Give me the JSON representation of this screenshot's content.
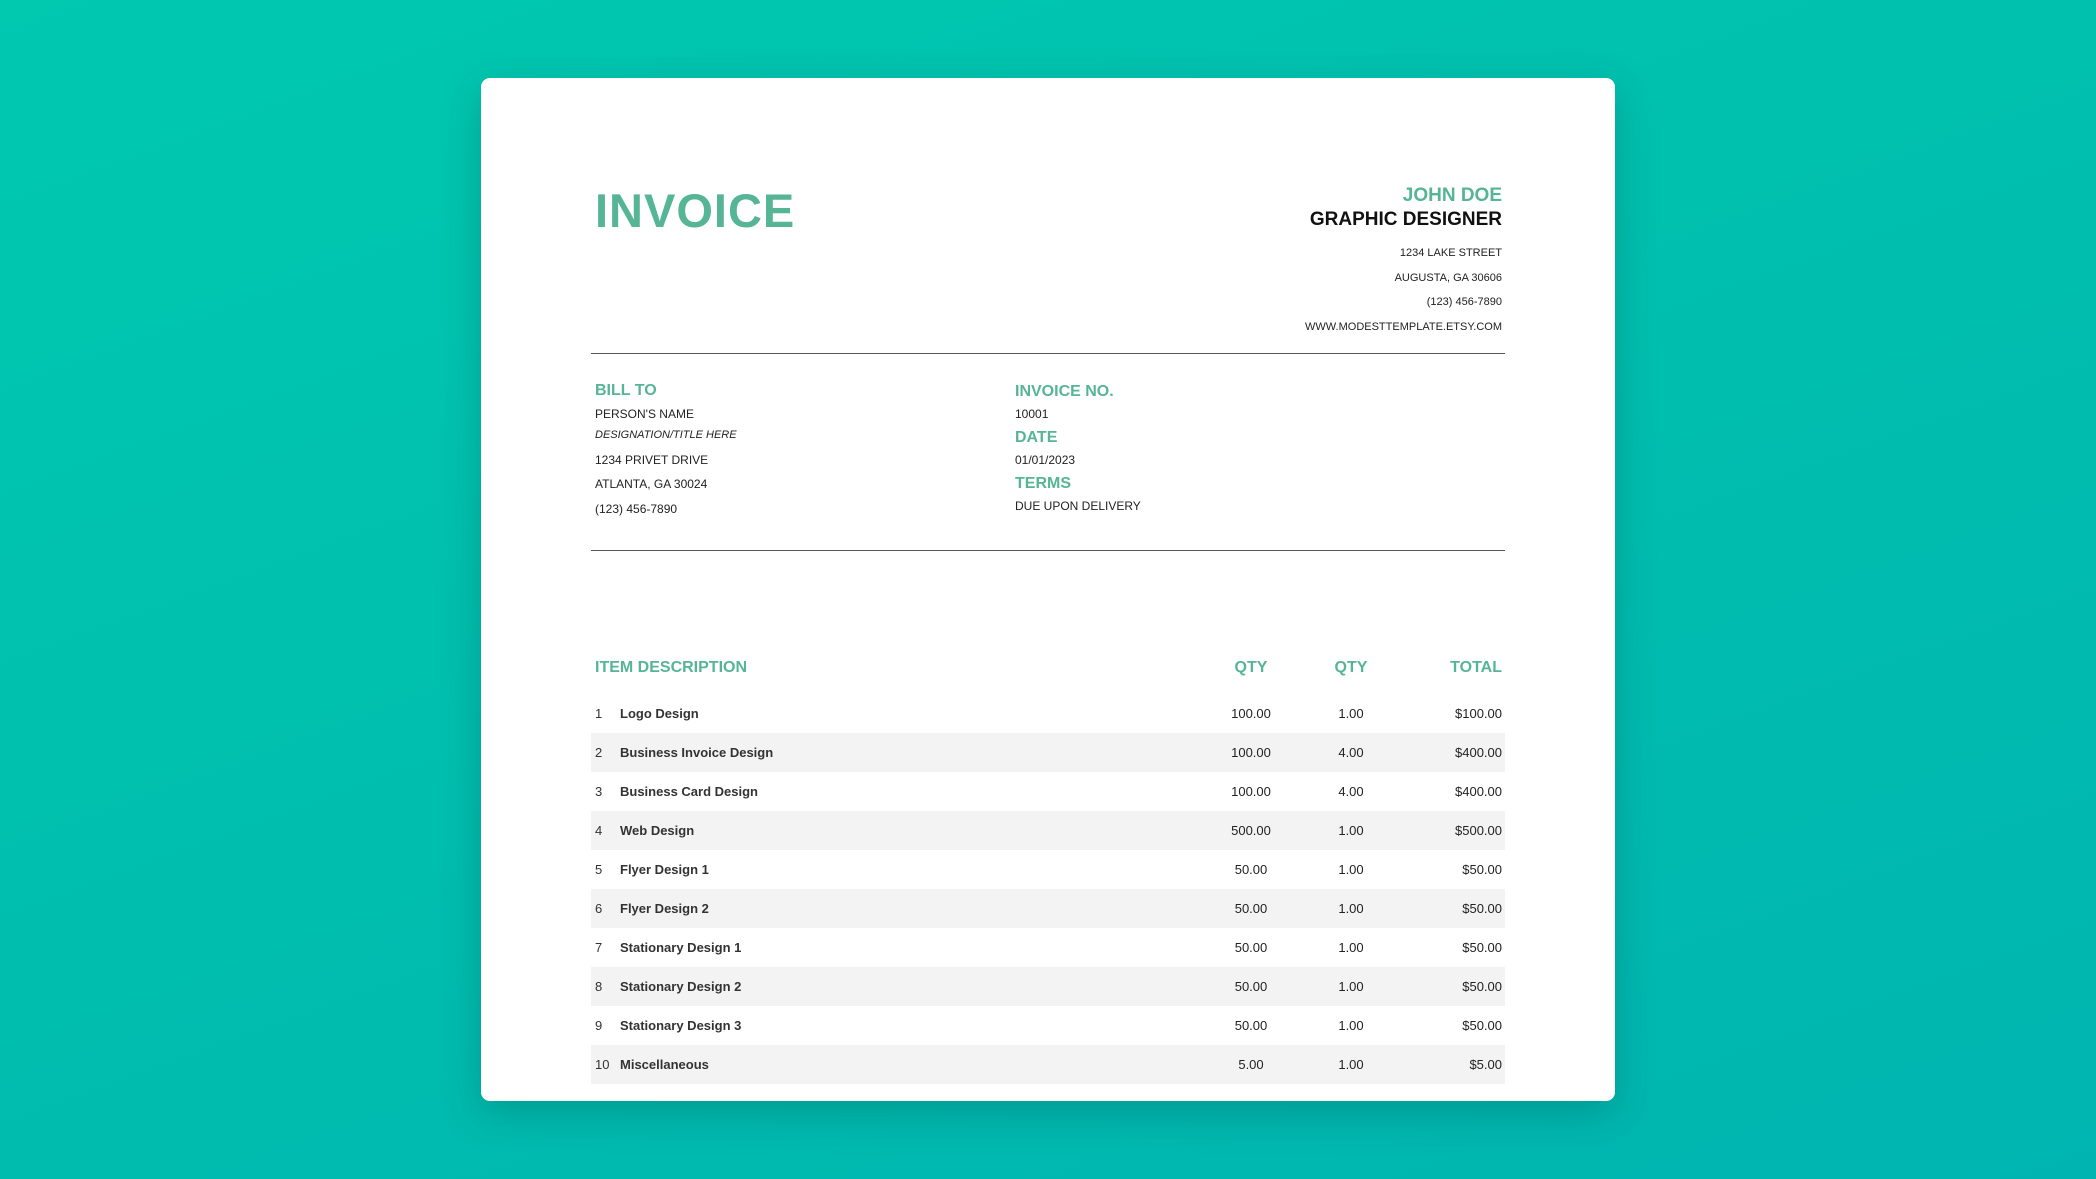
{
  "invoice": {
    "title": "INVOICE",
    "accent_color": "#55b594",
    "background_color": "#00c1ae"
  },
  "sender": {
    "name": "JOHN DOE",
    "role": "GRAPHIC DESIGNER",
    "street": "1234 LAKE STREET",
    "city": "AUGUSTA, GA 30606",
    "phone": "(123) 456-7890",
    "website": "WWW.MODESTTEMPLATE.ETSY.COM"
  },
  "bill_to": {
    "label": "BILL TO",
    "name": "PERSON'S NAME",
    "designation": "DESIGNATION/TITLE HERE",
    "street": "1234 PRIVET DRIVE",
    "city": "ATLANTA, GA 30024",
    "phone": "(123) 456-7890"
  },
  "details": {
    "invoice_no_label": "INVOICE NO.",
    "invoice_no": "10001",
    "date_label": "DATE",
    "date": "01/01/2023",
    "terms_label": "TERMS",
    "terms": "DUE UPON DELIVERY"
  },
  "table": {
    "headers": {
      "description": "ITEM DESCRIPTION",
      "col1": "QTY",
      "col2": "QTY",
      "total": "TOTAL"
    },
    "rows": [
      {
        "num": "1",
        "description": "Logo Design",
        "col1": "100.00",
        "col2": "1.00",
        "total": "$100.00"
      },
      {
        "num": "2",
        "description": "Business Invoice Design",
        "col1": "100.00",
        "col2": "4.00",
        "total": "$400.00"
      },
      {
        "num": "3",
        "description": "Business Card Design",
        "col1": "100.00",
        "col2": "4.00",
        "total": "$400.00"
      },
      {
        "num": "4",
        "description": "Web Design",
        "col1": "500.00",
        "col2": "1.00",
        "total": "$500.00"
      },
      {
        "num": "5",
        "description": "Flyer Design 1",
        "col1": "50.00",
        "col2": "1.00",
        "total": "$50.00"
      },
      {
        "num": "6",
        "description": "Flyer Design 2",
        "col1": "50.00",
        "col2": "1.00",
        "total": "$50.00"
      },
      {
        "num": "7",
        "description": "Stationary Design 1",
        "col1": "50.00",
        "col2": "1.00",
        "total": "$50.00"
      },
      {
        "num": "8",
        "description": "Stationary Design 2",
        "col1": "50.00",
        "col2": "1.00",
        "total": "$50.00"
      },
      {
        "num": "9",
        "description": "Stationary Design 3",
        "col1": "50.00",
        "col2": "1.00",
        "total": "$50.00"
      },
      {
        "num": "10",
        "description": "Miscellaneous",
        "col1": "5.00",
        "col2": "1.00",
        "total": "$5.00"
      }
    ]
  }
}
